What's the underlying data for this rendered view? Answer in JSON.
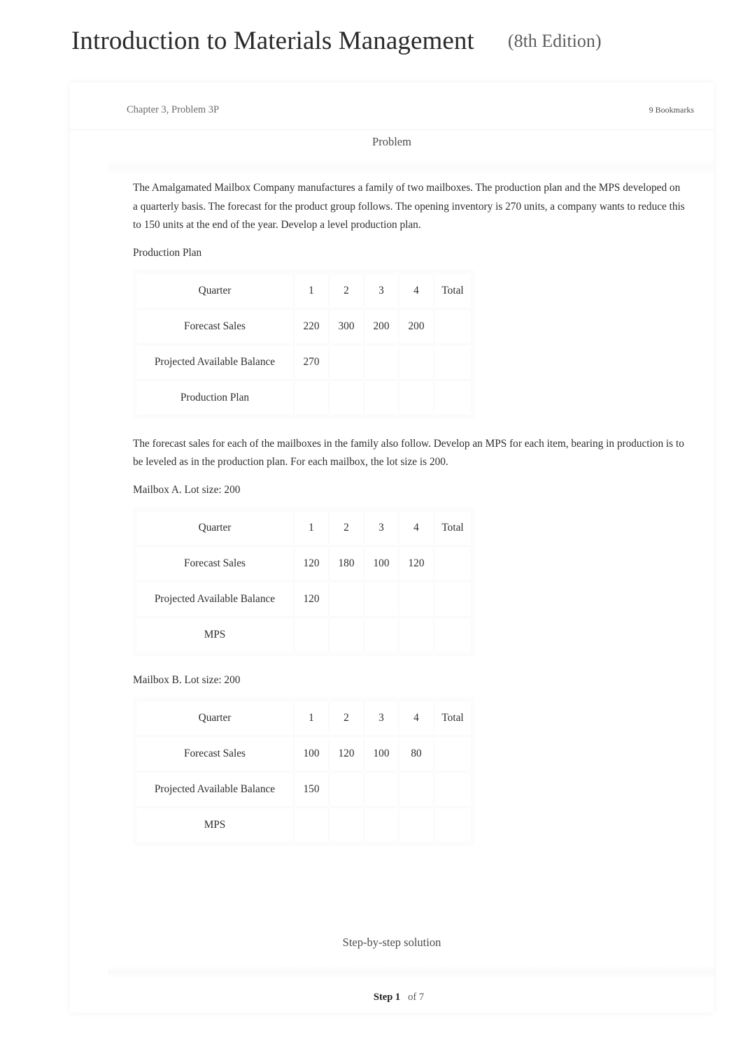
{
  "header": {
    "book_title": "Introduction to Materials Management",
    "edition": "(8th Edition)"
  },
  "chapter_bar": {
    "chapter": "Chapter 3, Problem 3P",
    "bookmarks": "9 Bookmarks"
  },
  "problem": {
    "section_heading": "Problem",
    "paragraph_1": "The Amalgamated Mailbox Company manufactures a family of two mailboxes. The production plan and the MPS developed on a quarterly basis. The forecast for the product group follows. The opening inventory is 270 units, a company wants to reduce this to 150 units at the end of the year. Develop a level production plan.",
    "label_production_plan": "Production Plan",
    "paragraph_2": "The forecast sales for each of the mailboxes in the family also follow. Develop an MPS for each item, bearing in production is to be leveled as in the production plan. For each mailbox, the lot size is 200.",
    "label_mailbox_a": "Mailbox A. Lot size: 200",
    "label_mailbox_b": "Mailbox B. Lot size: 200"
  },
  "tables": {
    "production_plan": {
      "header": [
        "Quarter",
        "1",
        "2",
        "3",
        "4",
        "Total"
      ],
      "rows": [
        {
          "label": "Forecast Sales",
          "cells": [
            "220",
            "300",
            "200",
            "200",
            ""
          ]
        },
        {
          "label": "Projected Available Balance",
          "cells": [
            "270",
            "",
            "",
            "",
            ""
          ]
        },
        {
          "label": "Production Plan",
          "cells": [
            "",
            "",
            "",
            "",
            ""
          ]
        }
      ]
    },
    "mailbox_a": {
      "header": [
        "Quarter",
        "1",
        "2",
        "3",
        "4",
        "Total"
      ],
      "rows": [
        {
          "label": "Forecast Sales",
          "cells": [
            "120",
            "180",
            "100",
            "120",
            ""
          ]
        },
        {
          "label": "Projected Available Balance",
          "cells": [
            "120",
            "",
            "",
            "",
            ""
          ]
        },
        {
          "label": "MPS",
          "cells": [
            "",
            "",
            "",
            "",
            ""
          ]
        }
      ]
    },
    "mailbox_b": {
      "header": [
        "Quarter",
        "1",
        "2",
        "3",
        "4",
        "Total"
      ],
      "rows": [
        {
          "label": "Forecast Sales",
          "cells": [
            "100",
            "120",
            "100",
            "80",
            ""
          ]
        },
        {
          "label": "Projected Available Balance",
          "cells": [
            "150",
            "",
            "",
            "",
            ""
          ]
        },
        {
          "label": "MPS",
          "cells": [
            "",
            "",
            "",
            "",
            ""
          ]
        }
      ]
    }
  },
  "solution": {
    "section_heading": "Step-by-step solution",
    "step_current": "Step 1",
    "step_total": "of 7"
  }
}
